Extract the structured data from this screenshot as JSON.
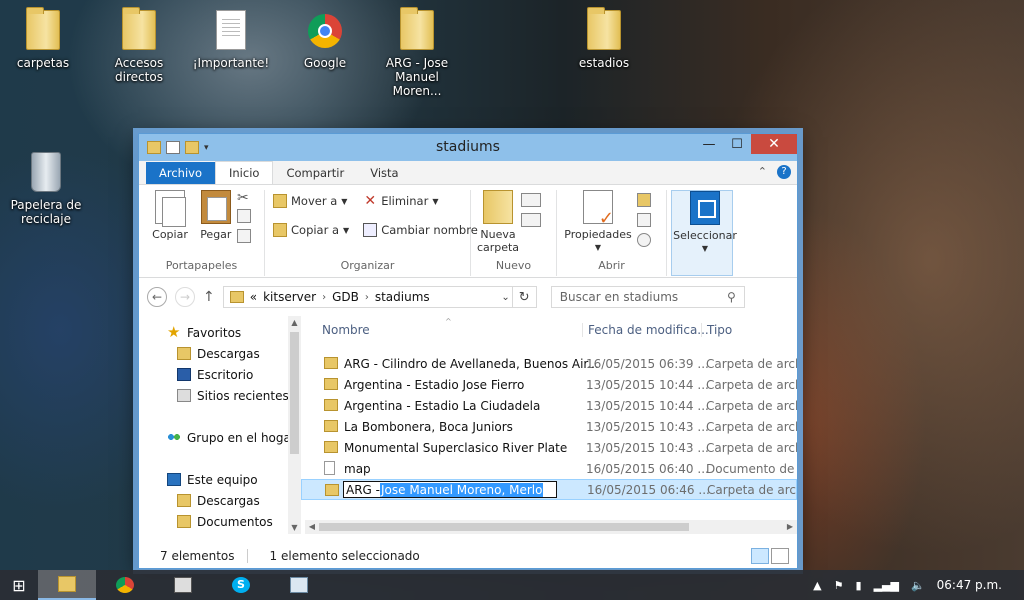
{
  "desktop": {
    "icons": [
      {
        "label": "carpetas"
      },
      {
        "label": "Accesos directos"
      },
      {
        "label": "¡Importante!"
      },
      {
        "label": "Google"
      },
      {
        "label": "ARG - Jose Manuel Moren..."
      },
      {
        "label": "estadios"
      },
      {
        "label": "Papelera de reciclaje"
      }
    ]
  },
  "window": {
    "title": "stadiums",
    "controls": {
      "minimize": "—",
      "maximize": "☐",
      "close": "✕"
    },
    "tabs": [
      "Archivo",
      "Inicio",
      "Compartir",
      "Vista"
    ],
    "ribbon": {
      "portapapeles": {
        "copy": "Copiar",
        "paste": "Pegar",
        "label": "Portapapeles"
      },
      "organizar": {
        "move": "Mover a",
        "copyto": "Copiar a",
        "delete": "Eliminar",
        "rename": "Cambiar nombre",
        "label": "Organizar"
      },
      "nuevo": {
        "newfolder_1": "Nueva",
        "newfolder_2": "carpeta",
        "label": "Nuevo"
      },
      "abrir": {
        "properties": "Propiedades",
        "label": "Abrir"
      },
      "seleccionar": {
        "label": "Seleccionar"
      }
    },
    "address": {
      "crumbs": [
        "kitserver",
        "GDB",
        "stadiums"
      ],
      "prefix": "«",
      "search_placeholder": "Buscar en stadiums"
    },
    "nav": {
      "favorites": "Favoritos",
      "downloads": "Descargas",
      "desktop": "Escritorio",
      "recent": "Sitios recientes",
      "homegroup": "Grupo en el hogar",
      "thispc": "Este equipo",
      "pc_downloads": "Descargas",
      "pc_documents": "Documentos"
    },
    "columns": {
      "name": "Nombre",
      "date": "Fecha de modifica...",
      "type": "Tipo"
    },
    "files": [
      {
        "name": "ARG - Cilindro de Avellaneda, Buenos Air...",
        "date": "16/05/2015 06:39 ...",
        "type": "Carpeta de archivos",
        "kind": "folder"
      },
      {
        "name": "Argentina - Estadio Jose Fierro",
        "date": "13/05/2015 10:44 ...",
        "type": "Carpeta de archivos",
        "kind": "folder"
      },
      {
        "name": "Argentina - Estadio La Ciudadela",
        "date": "13/05/2015 10:44 ...",
        "type": "Carpeta de archivos",
        "kind": "folder"
      },
      {
        "name": "La Bombonera, Boca Juniors",
        "date": "13/05/2015 10:43 ...",
        "type": "Carpeta de archivos",
        "kind": "folder"
      },
      {
        "name": "Monumental Superclasico River Plate",
        "date": "13/05/2015 10:43 ...",
        "type": "Carpeta de archivos",
        "kind": "folder"
      },
      {
        "name": "map",
        "date": "16/05/2015 06:40 ...",
        "type": "Documento de texto",
        "kind": "doc"
      }
    ],
    "renaming": {
      "prefix": "ARG - ",
      "selected": "Jose Manuel Moreno, Merlo",
      "date": "16/05/2015 06:46 ...",
      "type": "Carpeta de archivos"
    },
    "status": {
      "count": "7 elementos",
      "selected": "1 elemento seleccionado"
    }
  },
  "taskbar": {
    "clock": "06:47 p.m.",
    "tray_up": "▲"
  }
}
